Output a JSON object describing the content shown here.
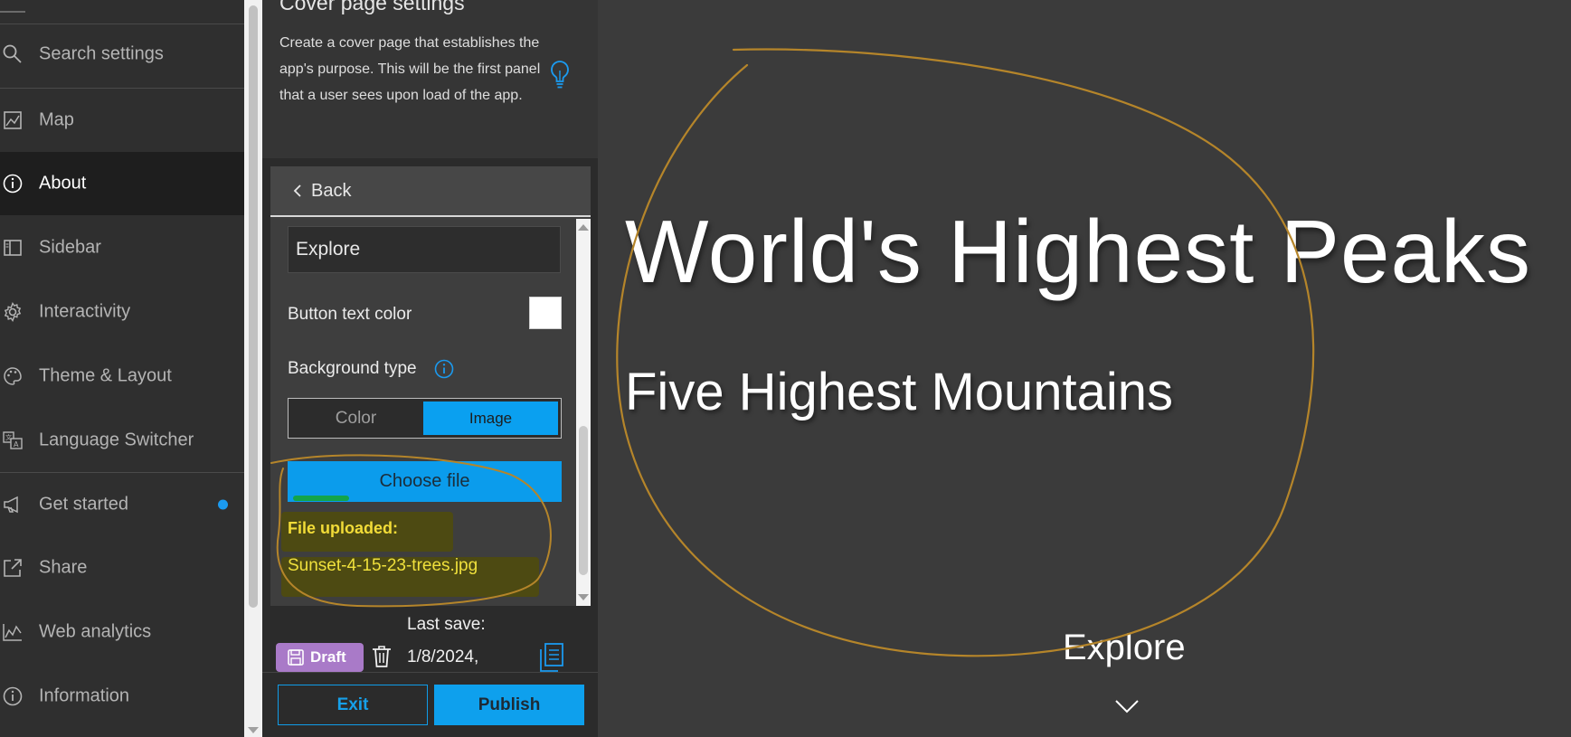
{
  "nav": {
    "items": [
      {
        "label": "Search settings",
        "icon": "search-icon"
      },
      {
        "label": "Map",
        "icon": "map-icon"
      },
      {
        "label": "About",
        "icon": "info-icon",
        "active": true
      },
      {
        "label": "Sidebar",
        "icon": "sidebar-icon"
      },
      {
        "label": "Interactivity",
        "icon": "gear-icon"
      },
      {
        "label": "Theme & Layout",
        "icon": "palette-icon"
      },
      {
        "label": "Language Switcher",
        "icon": "translate-icon"
      },
      {
        "label": "Get started",
        "icon": "megaphone-icon",
        "badge": "dot"
      },
      {
        "label": "Share",
        "icon": "share-icon"
      },
      {
        "label": "Web analytics",
        "icon": "analytics-icon"
      },
      {
        "label": "Information",
        "icon": "info-icon"
      }
    ]
  },
  "panel": {
    "title": "Cover page settings",
    "description": "Create a cover page that establishes the app's purpose. This will be the first panel that a user sees upon load of the app.",
    "back_label": "Back",
    "button_text_value": "Explore",
    "button_text_color_label": "Button text color",
    "button_text_color": "#ffffff",
    "background_type_label": "Background type",
    "background_options": [
      "Color",
      "Image"
    ],
    "background_selected": "Image",
    "choose_file_label": "Choose file",
    "file_uploaded_label": "File uploaded:",
    "file_name": "Sunset-4-15-23-trees.jpg"
  },
  "footer": {
    "draft_label": "Draft",
    "last_save_label": "Last save:",
    "last_save_date": "1/8/2024,",
    "exit_label": "Exit",
    "publish_label": "Publish"
  },
  "preview": {
    "title": "World's Highest Peaks",
    "subtitle": "Five Highest Mountains",
    "explore_label": "Explore"
  },
  "colors": {
    "accent": "#0ea0ed",
    "draft": "#a97ac8",
    "highlight_text": "#f2dc38",
    "annotation": "#b5852a"
  }
}
